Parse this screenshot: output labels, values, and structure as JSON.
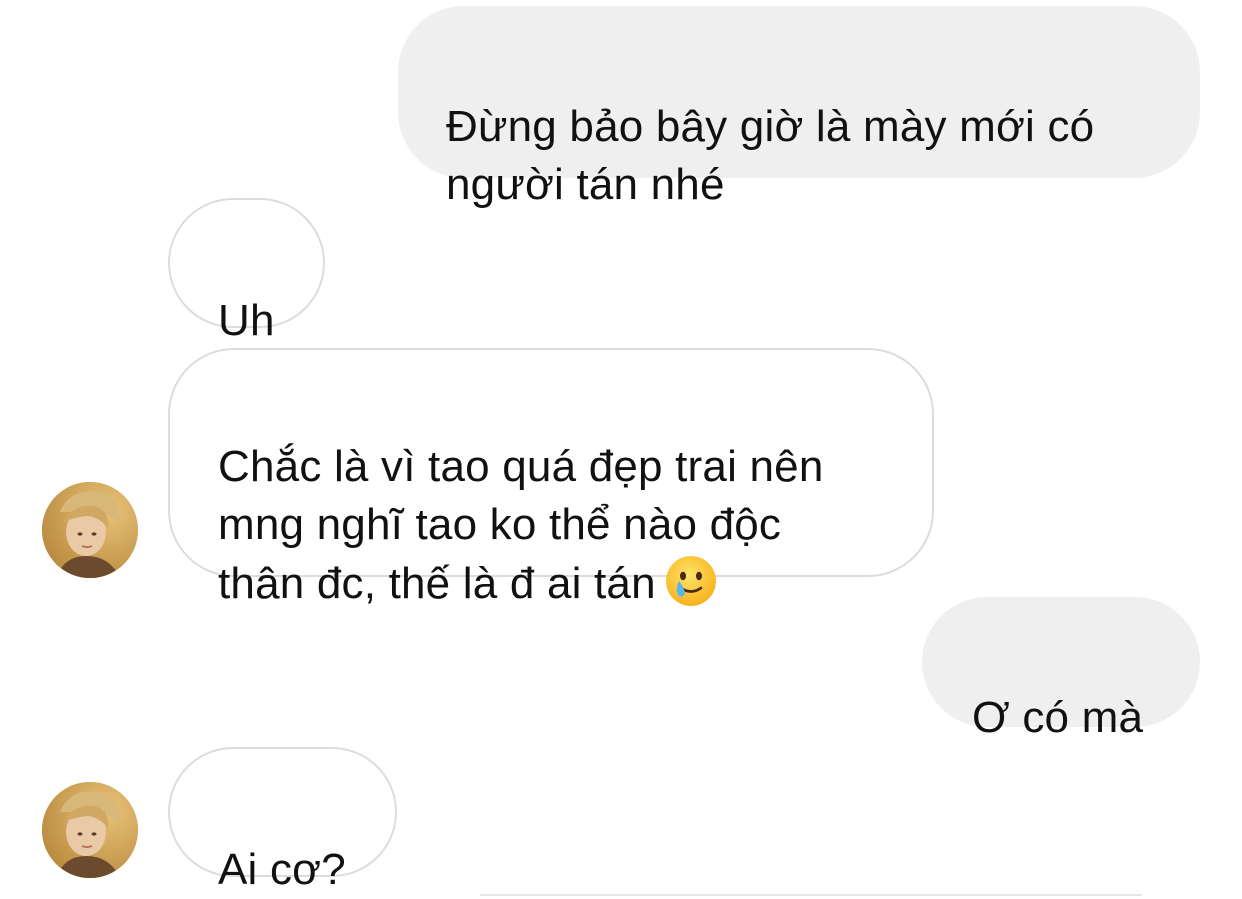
{
  "conversation": {
    "messages": [
      {
        "sender": "me",
        "text": "Đừng bảo bây giờ là mày mới có\nngười tán nhé"
      },
      {
        "sender": "them",
        "text": "Uh"
      },
      {
        "sender": "them",
        "text": "Chắc là vì tao quá đẹp trai nên\nmng nghĩ tao ko thể nào độc\nthân đc, thế là đ ai tán",
        "emoji": "smiling-face-with-tear-emoji"
      },
      {
        "sender": "me",
        "text": "Ơ có mà"
      },
      {
        "sender": "them",
        "text": "Ai cơ?"
      }
    ]
  },
  "icons": {
    "avatar": "contact-avatar-photo",
    "emoji": "smiling-face-with-tear-emoji"
  },
  "colors": {
    "sent_bubble": "#efefef",
    "received_border": "#dcdcdc",
    "text": "#111111",
    "background": "#ffffff"
  }
}
